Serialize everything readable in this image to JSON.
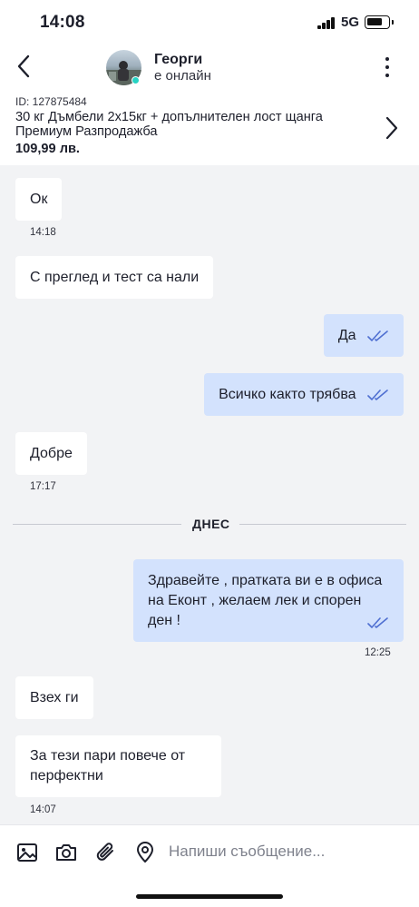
{
  "status_bar": {
    "time": "14:08",
    "network": "5G"
  },
  "header": {
    "user_name": "Георги",
    "user_status": "е онлайн"
  },
  "listing": {
    "id": "ID: 127875484",
    "title": "30 кг Дъмбели 2х15кг + допълнителен лост щанга Премиум Разпродажба",
    "price": "109,99 лв."
  },
  "messages": [
    {
      "direction": "in",
      "text": "Ок",
      "time": "14:18"
    },
    {
      "direction": "in",
      "text": "С преглед и тест са нали",
      "time": ""
    },
    {
      "direction": "out",
      "text": "Да",
      "time": ""
    },
    {
      "direction": "out",
      "text": "Всичко както трябва",
      "time": ""
    },
    {
      "direction": "in",
      "text": "Добре",
      "time": "17:17"
    },
    {
      "direction": "out",
      "text": "Здравейте , пратката ви е в офиса на Еконт , желаем лек и спорен ден !",
      "time": "12:25"
    },
    {
      "direction": "in",
      "text": "Взех ги",
      "time": ""
    },
    {
      "direction": "in",
      "text": "За тези пари повече от перфектни",
      "time": "14:07"
    }
  ],
  "day_separator": "ДНЕС",
  "composer": {
    "placeholder": "Напиши съобщение..."
  },
  "colors": {
    "outgoing_bubble": "#d3e2fd",
    "incoming_bubble": "#ffffff",
    "background": "#f2f3f5",
    "tick": "#4f6fd1",
    "online": "#27d3c3"
  }
}
